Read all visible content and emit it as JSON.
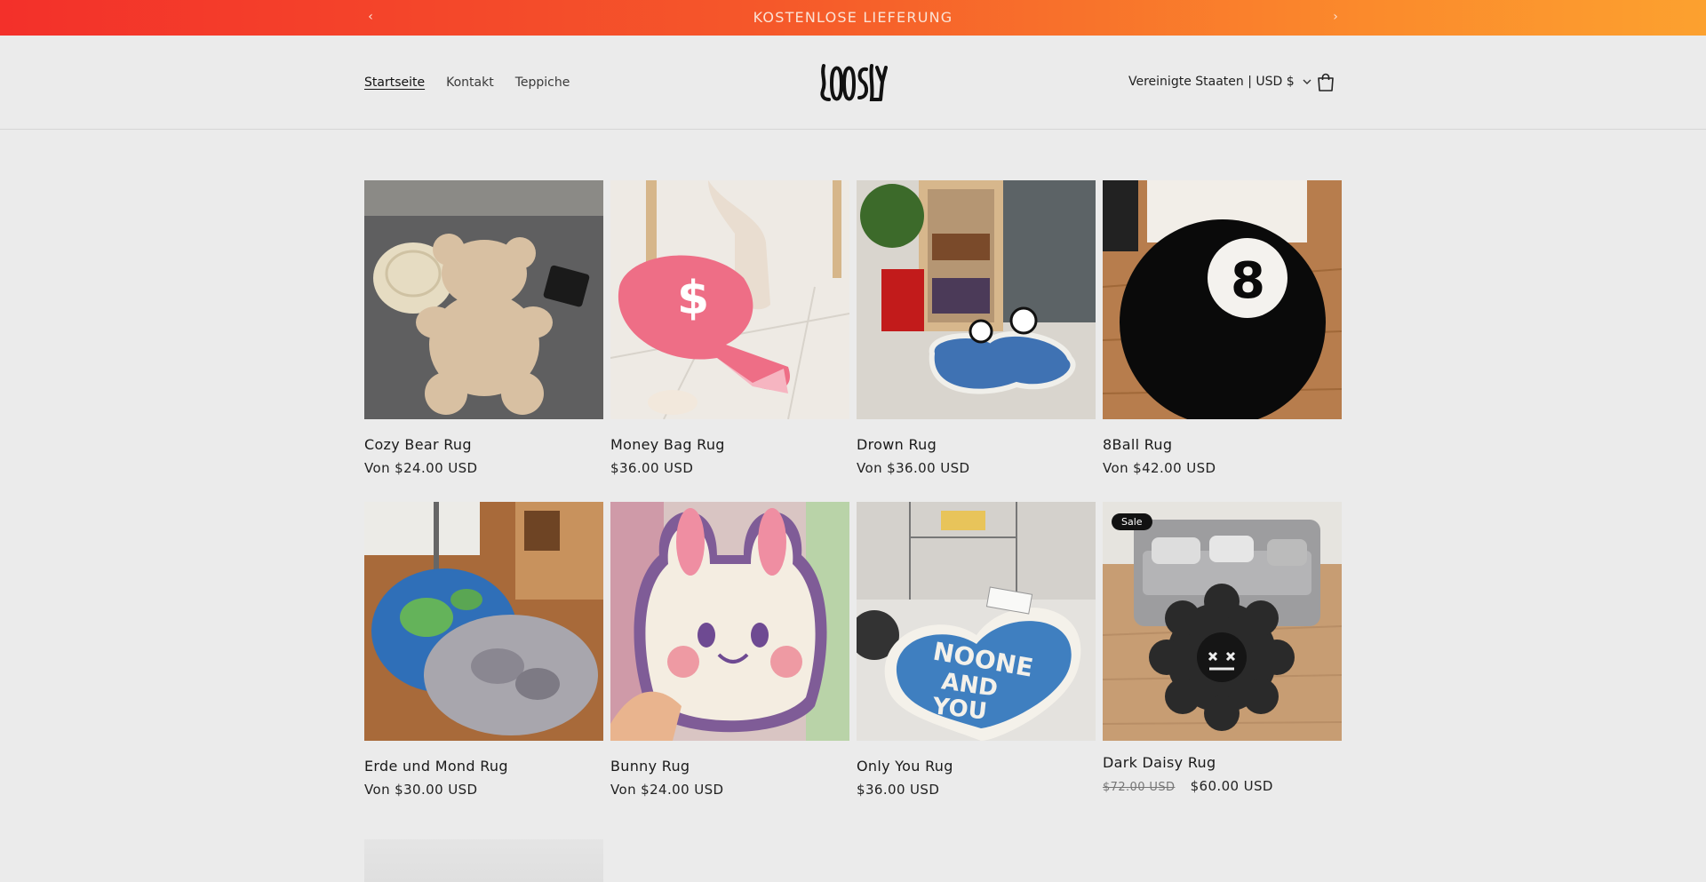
{
  "announcement": {
    "text": "KOSTENLOSE LIEFERUNG",
    "prev_icon": "chevron-left-icon",
    "next_icon": "chevron-right-icon"
  },
  "header": {
    "nav": [
      "Startseite",
      "Kontakt",
      "Teppiche"
    ],
    "logo_text": "LOOSLY",
    "country_selector": "Vereinigte Staaten | USD $",
    "cart_icon": "shopping-bag-icon"
  },
  "products": [
    {
      "title": "Cozy Bear Rug",
      "price": "Von $24.00 USD"
    },
    {
      "title": "Money Bag Rug",
      "price": "$36.00 USD"
    },
    {
      "title": "Drown Rug",
      "price": "Von $36.00 USD"
    },
    {
      "title": "8Ball Rug",
      "price": "Von $42.00 USD"
    },
    {
      "title": "Erde und Mond Rug",
      "price": "Von $30.00 USD"
    },
    {
      "title": "Bunny Rug",
      "price": "Von $24.00 USD"
    },
    {
      "title": "Only You Rug",
      "price": "$36.00 USD"
    },
    {
      "title": "Dark Daisy Rug",
      "price": "$60.00 USD",
      "compare_price": "$72.00 USD",
      "badge": "Sale"
    }
  ],
  "colors": {
    "announce_start": "#f3302a",
    "announce_end": "#fca12f",
    "background": "#ebebeb"
  }
}
